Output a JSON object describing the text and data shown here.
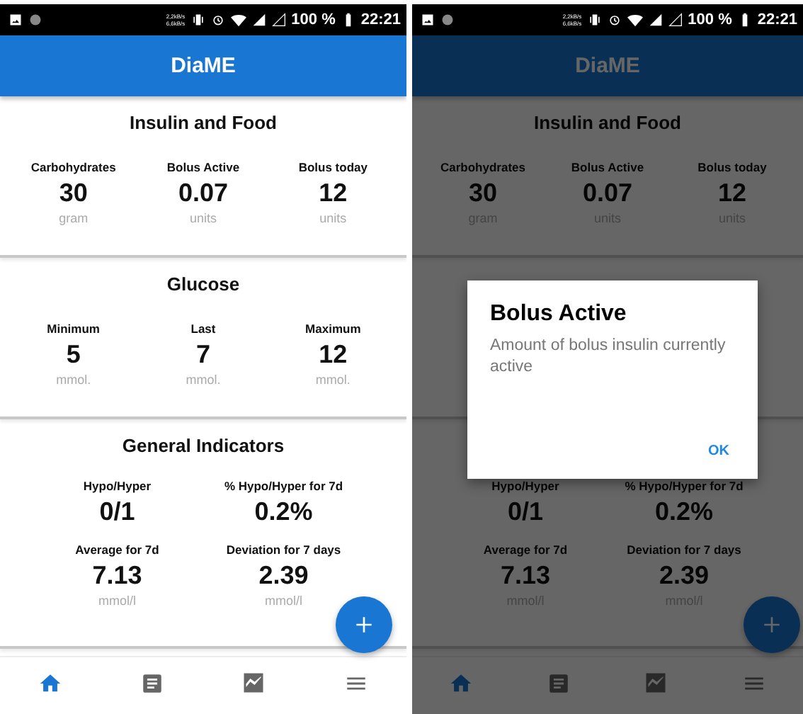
{
  "screens": [
    {
      "status_bar": {
        "network_speed": [
          "2,2kB/s",
          "6,6kB/s"
        ],
        "battery": "100 %",
        "time": "22:21"
      },
      "app_title": "DiaME",
      "sections": [
        {
          "title": "Insulin and Food",
          "kind": "row",
          "stats": [
            {
              "label": "Carbohydrates",
              "value": "30",
              "unit": "gram"
            },
            {
              "label": "Bolus Active",
              "value": "0.07",
              "unit": "units"
            },
            {
              "label": "Bolus today",
              "value": "12",
              "unit": "units"
            }
          ]
        },
        {
          "title": "Glucose",
          "kind": "row",
          "stats": [
            {
              "label": "Minimum",
              "value": "5",
              "unit": "mmol."
            },
            {
              "label": "Last",
              "value": "7",
              "unit": "mmol."
            },
            {
              "label": "Maximum",
              "value": "12",
              "unit": "mmol."
            }
          ]
        },
        {
          "title": "General Indicators",
          "kind": "grid",
          "stats": [
            {
              "label": "Hypo/Hyper",
              "value": "0/1"
            },
            {
              "label": "% Hypo/Hyper for 7d",
              "value": "0.2%"
            },
            {
              "label": "Average for 7d",
              "value": "7.13",
              "unit": "mmol/l"
            },
            {
              "label": "Deviation for 7 days",
              "value": "2.39",
              "unit": "mmol/l"
            }
          ]
        }
      ],
      "nav": [
        {
          "kind": "home",
          "selected": true
        },
        {
          "kind": "notes",
          "selected": false
        },
        {
          "kind": "chart",
          "selected": false
        },
        {
          "kind": "menu",
          "selected": false
        }
      ]
    },
    {
      "status_bar": {
        "network_speed": [
          "2,2kB/s",
          "6,6kB/s"
        ],
        "battery": "100 %",
        "time": "22:21"
      },
      "app_title": "DiaME",
      "sections": [
        {
          "title": "Insulin and Food",
          "kind": "row",
          "stats": [
            {
              "label": "Carbohydrates",
              "value": "30",
              "unit": "gram"
            },
            {
              "label": "Bolus Active",
              "value": "0.07",
              "unit": "units"
            },
            {
              "label": "Bolus today",
              "value": "12",
              "unit": "units"
            }
          ]
        },
        {
          "kind": "row"
        },
        {
          "kind": "grid",
          "stats": [
            {
              "label": "Hypo/Hyper",
              "value": "0/1"
            },
            {
              "label": "% Hypo/Hyper for 7d",
              "value": "0.2%"
            },
            {
              "label": "Average for 7d",
              "value": "7.13",
              "unit": "mmol/l"
            },
            {
              "label": "Deviation for 7 days",
              "value": "2.39",
              "unit": "mmol/l"
            }
          ]
        }
      ],
      "nav": [
        {
          "kind": "home",
          "selected": true
        },
        {
          "kind": "notes",
          "selected": false
        },
        {
          "kind": "chart",
          "selected": false
        },
        {
          "kind": "menu",
          "selected": false
        }
      ],
      "dialog": {
        "title": "Bolus Active",
        "message": "Amount of bolus insulin currently active",
        "button": "OK"
      }
    }
  ]
}
